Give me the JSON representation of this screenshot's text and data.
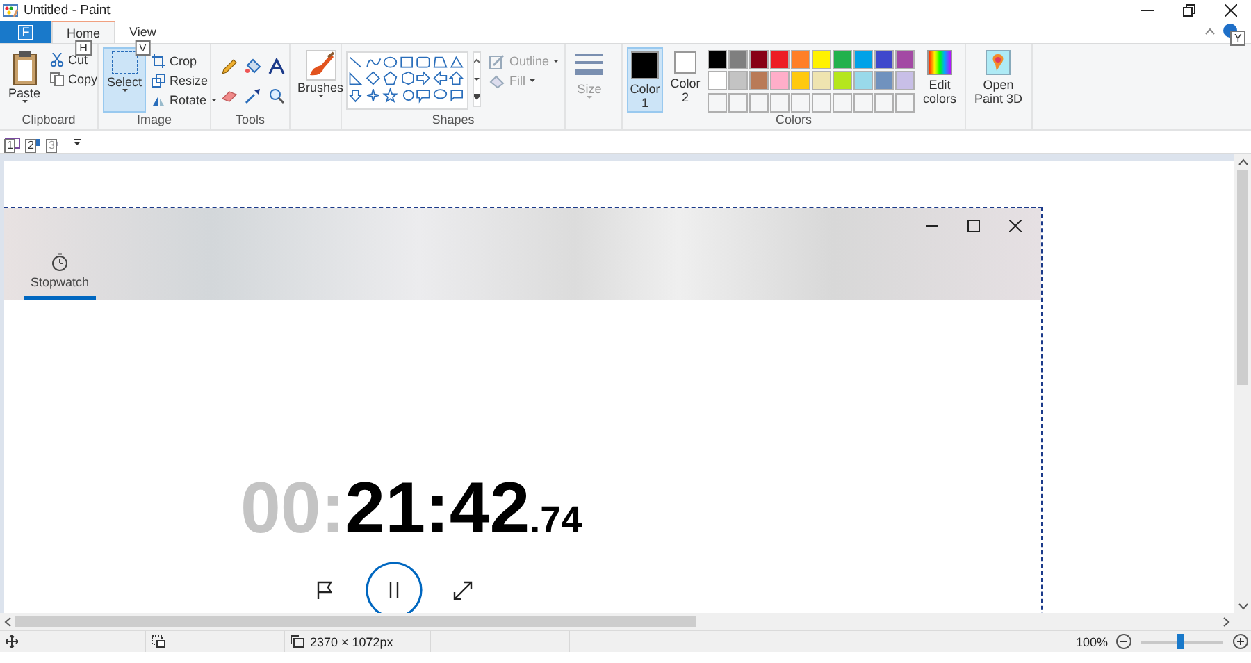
{
  "window": {
    "title": "Untitled - Paint"
  },
  "ribbon_tabs": [
    {
      "label": "F",
      "kind": "file",
      "selected": false
    },
    {
      "label": "Home",
      "kind": "tab",
      "selected": true,
      "keytip": "H"
    },
    {
      "label": "View",
      "kind": "tab",
      "selected": false,
      "keytip": "V"
    }
  ],
  "help_keytip": "Y",
  "clipboard": {
    "label": "Clipboard",
    "paste": "Paste",
    "cut": "Cut",
    "copy": "Copy"
  },
  "image": {
    "label": "Image",
    "select": {
      "label": "Select",
      "selected": true
    },
    "crop": "Crop",
    "resize": "Resize",
    "rotate": "Rotate"
  },
  "tools": {
    "label": "Tools"
  },
  "brushes": {
    "label": "Brushes"
  },
  "shapes": {
    "label": "Shapes",
    "outline": {
      "label": "Outline",
      "disabled": true
    },
    "fill": {
      "label": "Fill",
      "disabled": true
    }
  },
  "size": {
    "label": "Size",
    "disabled": true
  },
  "colors": {
    "label": "Colors",
    "slots": [
      {
        "label": "Color",
        "index": "1",
        "selected": true,
        "color": "#000000"
      },
      {
        "label": "Color",
        "index": "2",
        "selected": false,
        "color": "#ffffff"
      }
    ],
    "palette": [
      {
        "color": "#000000"
      },
      {
        "color": "#7f7f7f"
      },
      {
        "color": "#880015"
      },
      {
        "color": "#ed1c24"
      },
      {
        "color": "#ff7f27"
      },
      {
        "color": "#fff200"
      },
      {
        "color": "#22b14c"
      },
      {
        "color": "#00a2e8"
      },
      {
        "color": "#3f48cc"
      },
      {
        "color": "#a349a4"
      },
      {
        "color": "#ffffff"
      },
      {
        "color": "#c3c3c3"
      },
      {
        "color": "#b97a57"
      },
      {
        "color": "#ffaec9"
      },
      {
        "color": "#ffc90e"
      },
      {
        "color": "#efe4b0"
      },
      {
        "color": "#b5e61d"
      },
      {
        "color": "#99d9ea"
      },
      {
        "color": "#7092be"
      },
      {
        "color": "#c8bfe7"
      },
      {
        "kind": "empty"
      },
      {
        "kind": "empty"
      },
      {
        "kind": "empty"
      },
      {
        "kind": "empty"
      },
      {
        "kind": "empty"
      },
      {
        "kind": "empty"
      },
      {
        "kind": "empty"
      },
      {
        "kind": "empty"
      },
      {
        "kind": "empty"
      },
      {
        "kind": "empty"
      }
    ],
    "edit_colors": [
      "Edit",
      "colors"
    ]
  },
  "paint3d": [
    "Open",
    "Paint 3D"
  ],
  "quick_access": [
    {
      "kind": "save",
      "keytip": "1",
      "disabled": false
    },
    {
      "kind": "undo",
      "keytip": "2",
      "disabled": false
    },
    {
      "kind": "redo",
      "keytip": "3",
      "disabled": true
    }
  ],
  "clock": {
    "tabs": [
      {
        "label": "Stopwatch",
        "selected": true
      }
    ],
    "time_dim": "00:",
    "time_main": "21:42",
    "time_fraction": ".74"
  },
  "status": {
    "dimensions": "2370 × 1072px",
    "zoom": "100%",
    "level": 0.5
  }
}
